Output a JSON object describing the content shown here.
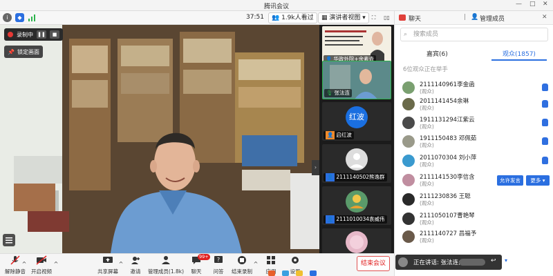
{
  "window": {
    "title": "腾讯会议",
    "controls": [
      "—",
      "□",
      "✕"
    ]
  },
  "toolbar": {
    "timer": "37:51",
    "viewers": "1.9k人看过",
    "layout": "演讲者视图"
  },
  "recording": {
    "label": "录制中"
  },
  "lock_screen": {
    "label": "锁定画面"
  },
  "participants_strip": [
    {
      "name": "华政外院+余素青",
      "type": "video-slide"
    },
    {
      "name": "张法连",
      "type": "video"
    },
    {
      "name": "启红波",
      "type": "avatar",
      "avatar_text": "红波",
      "avatar_color": "#1a6fe0"
    },
    {
      "name": "2111140502熊逸群",
      "type": "avatar-empty"
    },
    {
      "name": "2111010034袁威伟",
      "type": "avatar-photo"
    },
    {
      "name": "",
      "type": "avatar-photo-pink"
    }
  ],
  "bottom_bar": {
    "mute": "解除静音",
    "video": "开启视频",
    "share": "共享屏幕",
    "invite": "邀请",
    "manage": "管理成员(1.8k)",
    "chat": "聊天",
    "chat_badge": "99+",
    "qa": "问答",
    "end_record": "结束录制",
    "apps": "应用",
    "settings": "设置",
    "end_meeting": "结束会议"
  },
  "panel": {
    "tab_chat": "聊天",
    "tab_manage": "管理成员",
    "search_placeholder": "搜索成员",
    "tab_guests": "嘉宾(6)",
    "tab_audience": "观众(1857)",
    "hand_hint": "6位观众正在举手",
    "members": [
      {
        "name": "2111140961李金函",
        "role": "(观众)",
        "hand": true
      },
      {
        "name": "2011141454余琳",
        "role": "(观众)",
        "hand": true
      },
      {
        "name": "1911131294江紫云",
        "role": "(观众)",
        "hand": true
      },
      {
        "name": "1911150483 邓佩茹",
        "role": "(观众)",
        "hand": true
      },
      {
        "name": "2011070304 刘小萍",
        "role": "(观众)",
        "hand": true
      },
      {
        "name": "2111141530李信含",
        "role": "(观众)",
        "hand": false
      },
      {
        "name": "2111230836 王聪",
        "role": "(观众)",
        "hand": false
      },
      {
        "name": "2111050107曹艳琴",
        "role": "(观众)",
        "hand": false
      },
      {
        "name": "2111140727 昌福予",
        "role": "(观众)",
        "hand": false
      }
    ],
    "allow_speak": "允许发言",
    "more": "更多 ▾"
  },
  "speaking": {
    "label": "正在讲话: 张法连;"
  },
  "colors": {
    "accent": "#2b6fe0",
    "danger": "#e02020",
    "record": "#e53935"
  }
}
